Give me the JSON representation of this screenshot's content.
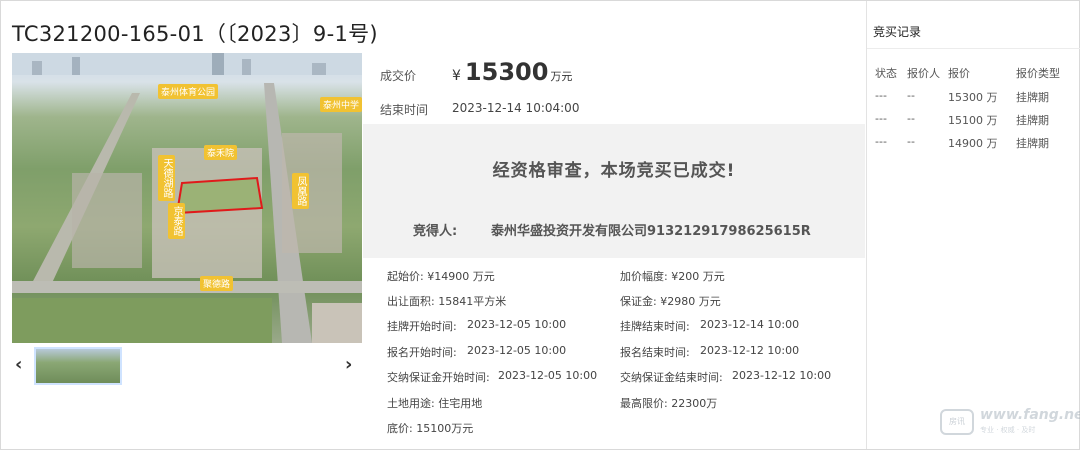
{
  "title": "TC321200-165-01（〔2023〕9-1号)",
  "deal": {
    "price_label": "成交价",
    "currency": "¥",
    "price": "15300",
    "unit": "万元",
    "end_label": "结束时间",
    "end_time": "2023-12-14 10:04:00"
  },
  "panel": {
    "message": "经资格审查，本场竞买已成交!",
    "winner_label": "竞得人:",
    "winner": "泰州华盛投资开发有限公司91321291798625615R"
  },
  "details": {
    "start_price": "起始价: ¥14900 万元",
    "increment": "加价幅度: ¥200 万元",
    "area": "出让面积: 15841平方米",
    "deposit": "保证金: ¥2980 万元",
    "listing_start_label": "挂牌开始时间:",
    "listing_start": "2023-12-05 10:00",
    "listing_end_label": "挂牌结束时间:",
    "listing_end": "2023-12-14 10:00",
    "signup_start_label": "报名开始时间:",
    "signup_start": "2023-12-05 10:00",
    "signup_end_label": "报名结束时间:",
    "signup_end": "2023-12-12 10:00",
    "deposit_start_label": "交纳保证金开始时间:",
    "deposit_start": "2023-12-05 10:00",
    "deposit_end_label": "交纳保证金结束时间:",
    "deposit_end": "2023-12-12 10:00",
    "land_use": "土地用途: 住宅用地",
    "max_price": "最高限价: 22300万",
    "floor_price": "底价: 15100万元"
  },
  "photo": {
    "tags": [
      "泰州体育公园",
      "泰州中学",
      "泰禾院",
      "天德湖路",
      "京泰路",
      "聚德路",
      "凤凰路"
    ]
  },
  "records": {
    "title": "竞买记录",
    "headers": [
      "状态",
      "报价人",
      "报价",
      "报价类型"
    ],
    "rows": [
      [
        "---",
        "--",
        "15300 万",
        "挂牌期"
      ],
      [
        "---",
        "--",
        "15100 万",
        "挂牌期"
      ],
      [
        "---",
        "--",
        "14900 万",
        "挂牌期"
      ]
    ]
  },
  "watermark": {
    "badge": "房讯",
    "text": "www.fang.net",
    "sub": "专业 · 权威 · 及时"
  }
}
